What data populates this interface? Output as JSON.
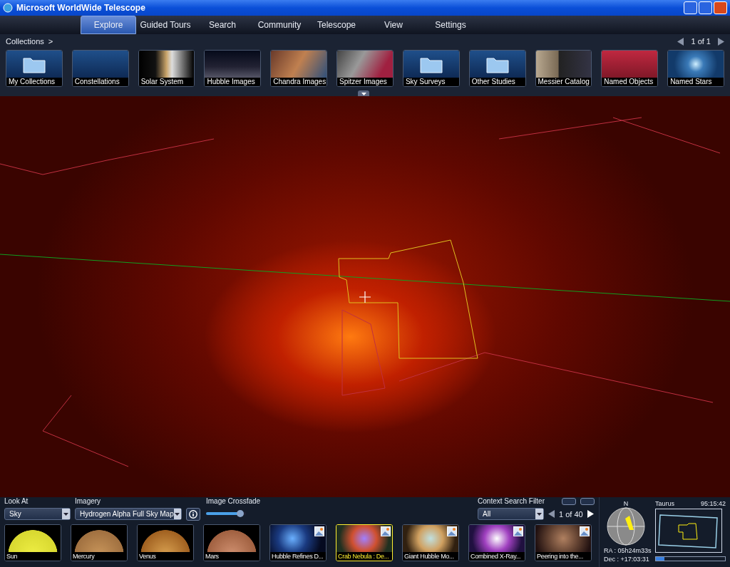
{
  "window": {
    "title": "Microsoft WorldWide Telescope"
  },
  "tabs": [
    {
      "label": "Explore",
      "selected": true
    },
    {
      "label": "Guided Tours",
      "selected": false
    },
    {
      "label": "Search",
      "selected": false
    },
    {
      "label": "Community",
      "selected": false
    },
    {
      "label": "Telescope",
      "selected": false
    },
    {
      "label": "View",
      "selected": false
    },
    {
      "label": "Settings",
      "selected": false
    }
  ],
  "collections": {
    "breadcrumb": "Collections",
    "chevron": ">",
    "pager": "1 of 1",
    "items": [
      {
        "label": "My Collections",
        "kind": "folder"
      },
      {
        "label": "Constellations",
        "kind": "image"
      },
      {
        "label": "Solar System",
        "kind": "image"
      },
      {
        "label": "Hubble Images",
        "kind": "image"
      },
      {
        "label": "Chandra Images",
        "kind": "image"
      },
      {
        "label": "Spitzer Images",
        "kind": "image"
      },
      {
        "label": "Sky Surveys",
        "kind": "folder"
      },
      {
        "label": "Other Studies",
        "kind": "folder"
      },
      {
        "label": "Messier Catalog",
        "kind": "image"
      },
      {
        "label": "Named Objects",
        "kind": "image"
      },
      {
        "label": "Named Stars",
        "kind": "image"
      }
    ]
  },
  "controls": {
    "look_at": {
      "label": "Look At",
      "value": "Sky"
    },
    "imagery": {
      "label": "Imagery",
      "value": "Hydrogen Alpha Full Sky Map"
    },
    "crossfade": {
      "label": "Image Crossfade",
      "level": 0.85
    },
    "context_filter": {
      "label": "Context Search Filter",
      "value": "All"
    },
    "pager": "1 of 40"
  },
  "thumbnails": [
    {
      "label": "Sun",
      "selected": false
    },
    {
      "label": "Mercury",
      "selected": false
    },
    {
      "label": "Venus",
      "selected": false
    },
    {
      "label": "Mars",
      "selected": false
    },
    {
      "label": "Hubble Refines D...",
      "selected": false
    },
    {
      "label": "Crab Nebula : De...",
      "selected": true
    },
    {
      "label": "Giant Hubble Mo...",
      "selected": false
    },
    {
      "label": "Combined X-Ray...",
      "selected": false
    },
    {
      "label": "Peering into the...",
      "selected": false
    }
  ],
  "navigator": {
    "north": "N",
    "ra": "RA : 05h24m33s",
    "dec": "Dec : +17:03:31",
    "constellation": "Taurus",
    "time": "95:15:42",
    "progress": {
      "level": 0.12
    }
  }
}
